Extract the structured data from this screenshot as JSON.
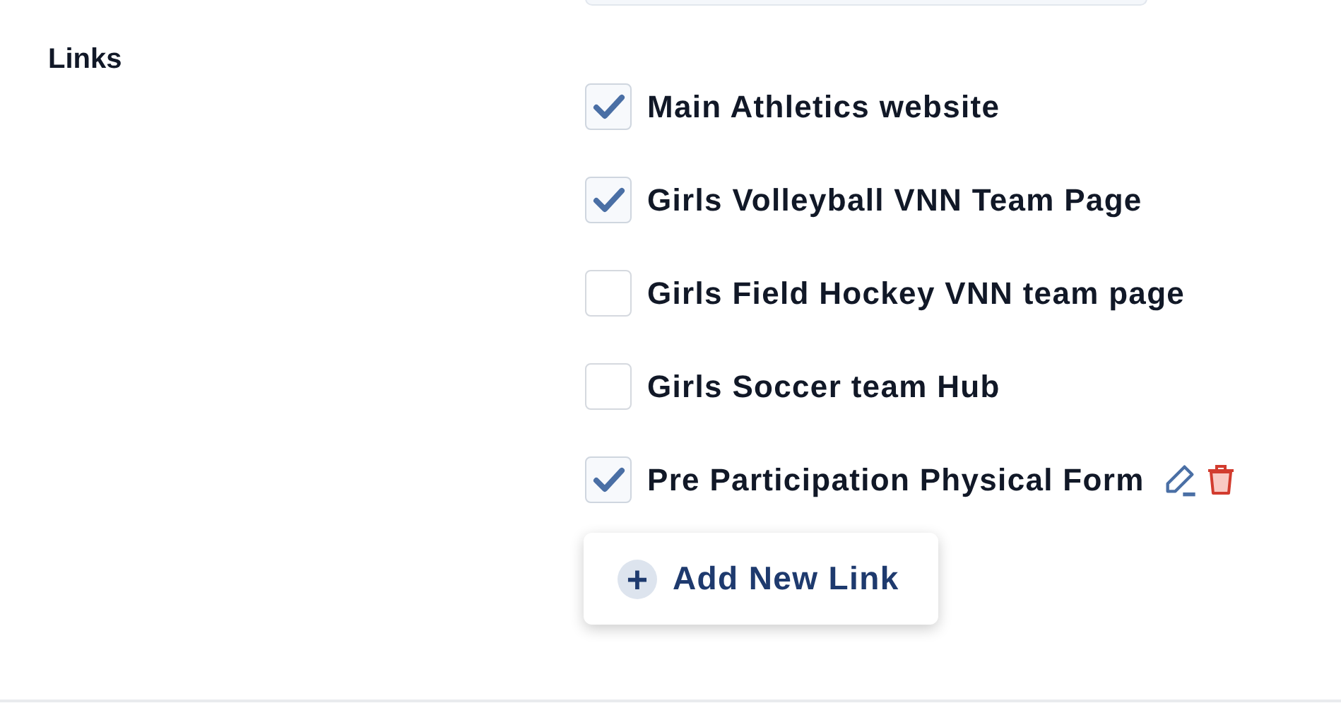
{
  "section": {
    "label": "Links"
  },
  "links": [
    {
      "label": "Main Athletics website",
      "checked": true,
      "hovered": false
    },
    {
      "label": "Girls Volleyball VNN Team Page",
      "checked": true,
      "hovered": false
    },
    {
      "label": "Girls Field Hockey VNN team page",
      "checked": false,
      "hovered": false
    },
    {
      "label": "Girls Soccer team Hub",
      "checked": false,
      "hovered": false
    },
    {
      "label": "Pre Participation Physical Form",
      "checked": true,
      "hovered": true
    }
  ],
  "add_button": {
    "icon": "+",
    "label": "Add New Link"
  }
}
